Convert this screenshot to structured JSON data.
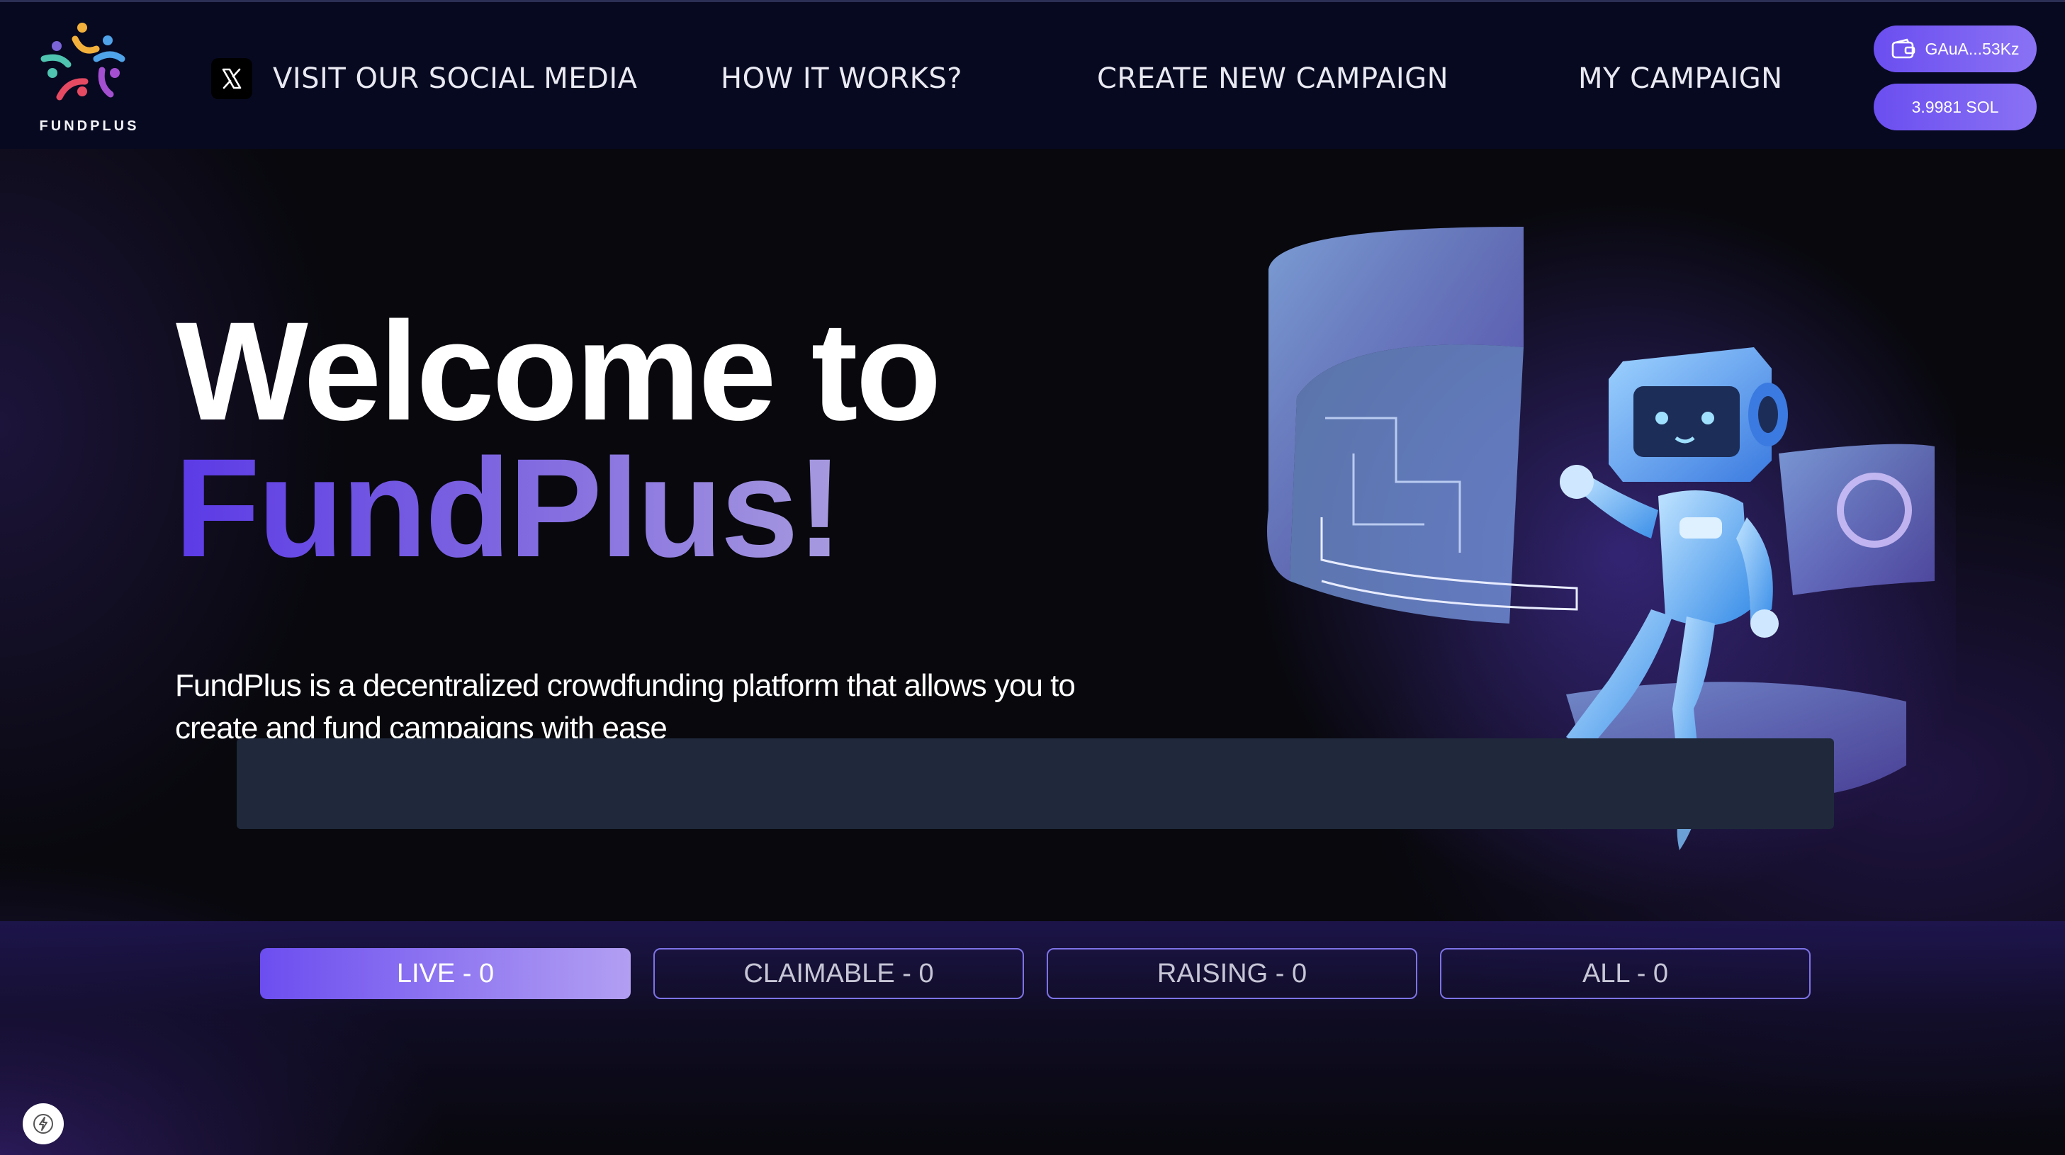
{
  "header": {
    "logo_text": "FUNDPLUS",
    "nav": {
      "social": "VISIT OUR SOCIAL MEDIA",
      "how": "HOW IT WORKS?",
      "create": "CREATE NEW CAMPAIGN",
      "my": "MY CAMPAIGN"
    },
    "wallet": {
      "address": "GAuA...53Kz",
      "balance": "3.9981 SOL"
    }
  },
  "hero": {
    "title_line1": "Welcome to",
    "title_line2": "FundPlus!",
    "description": "FundPlus is a decentralized crowdfunding platform that allows you to create and fund campaigns with ease"
  },
  "tabs": [
    {
      "label": "LIVE - 0",
      "active": true
    },
    {
      "label": "CLAIMABLE - 0",
      "active": false
    },
    {
      "label": "RAISING - 0",
      "active": false
    },
    {
      "label": "ALL - 0",
      "active": false
    }
  ],
  "colors": {
    "header_bg": "#070921",
    "accent": "#6b4ef0",
    "overlay_bar": "#1f293b"
  },
  "icons": {
    "social": "x-logo-icon",
    "wallet": "wallet-icon",
    "dev": "lightning-icon"
  }
}
